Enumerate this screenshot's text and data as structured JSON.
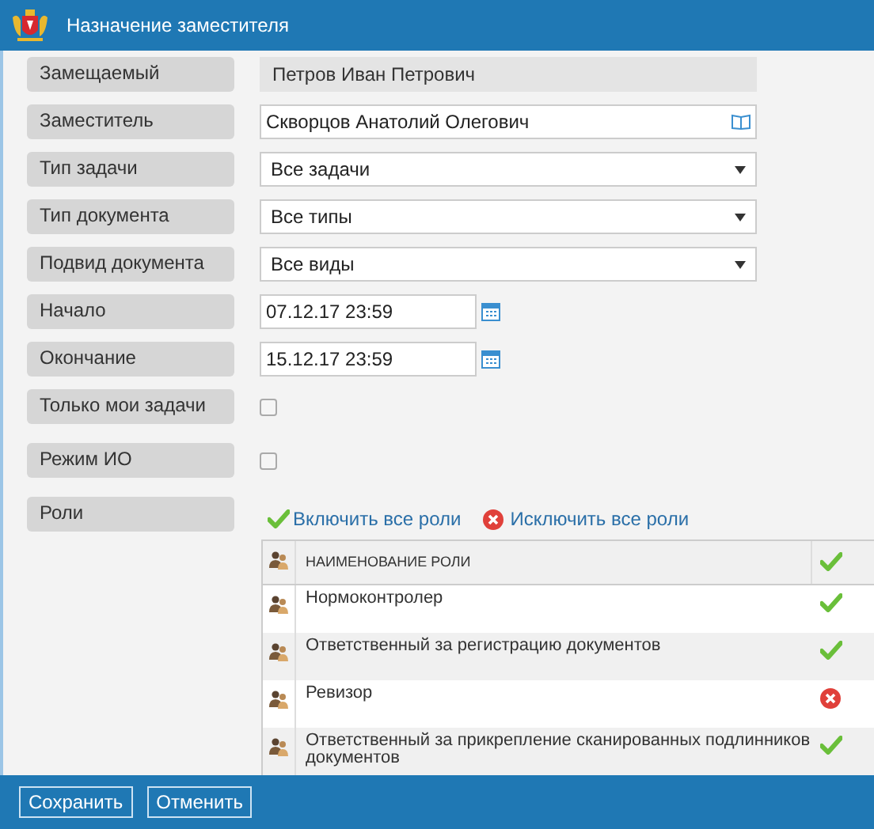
{
  "window": {
    "title": "Назначение заместителя"
  },
  "fields": [
    {
      "kind": "readonly",
      "label": "Замещаемый",
      "value": "Петров Иван Петрович"
    },
    {
      "kind": "lookup",
      "label": "Заместитель",
      "value": "Скворцов Анатолий Олегович"
    },
    {
      "kind": "select",
      "label": "Тип задачи",
      "value": "Все задачи"
    },
    {
      "kind": "select",
      "label": "Тип документа",
      "value": "Все типы"
    },
    {
      "kind": "select",
      "label": "Подвид документа",
      "value": "Все виды"
    },
    {
      "kind": "date",
      "label": "Начало",
      "value": "07.12.17 23:59"
    },
    {
      "kind": "date",
      "label": "Окончание",
      "value": "15.12.17 23:59"
    },
    {
      "kind": "checkbox",
      "label": "Только мои задачи",
      "checked": false
    },
    {
      "kind": "checkbox",
      "label": "Режим ИО",
      "checked": false
    }
  ],
  "roles": {
    "label": "Роли",
    "include_all": "Включить все роли",
    "exclude_all": "Исключить все роли",
    "column": "НАИМЕНОВАНИЕ РОЛИ",
    "rows": [
      {
        "name": "Нормоконтролер",
        "included": true
      },
      {
        "name": "Ответственный за регистрацию документов",
        "included": true
      },
      {
        "name": "Ревизор",
        "included": false
      },
      {
        "name": "Ответственный за прикрепление сканированных подлинников документов",
        "included": true
      }
    ]
  },
  "buttons": [
    "Сохранить",
    "Отменить"
  ]
}
